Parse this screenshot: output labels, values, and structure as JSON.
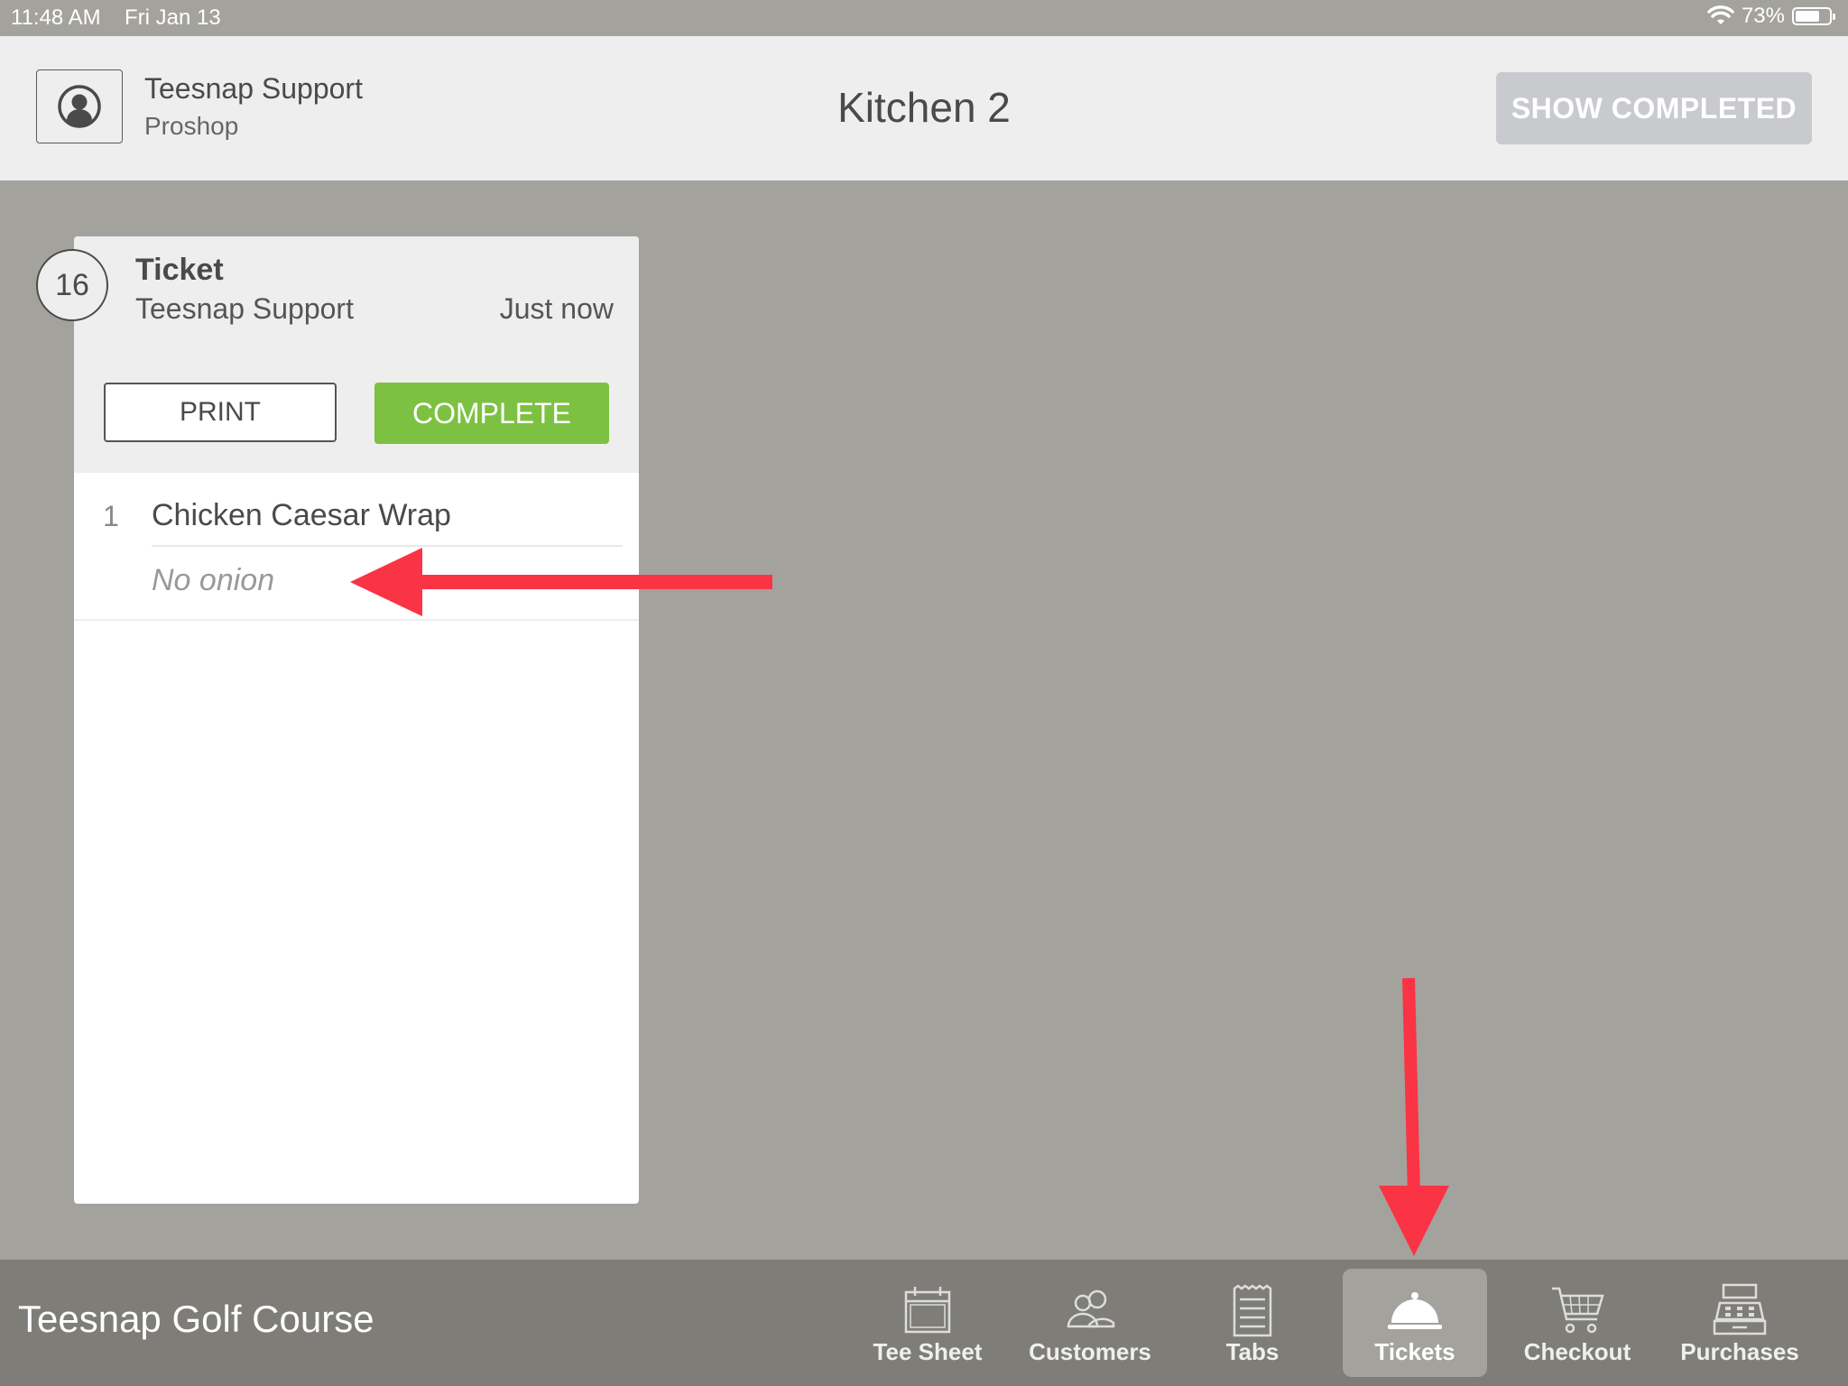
{
  "status_bar": {
    "time": "11:48 AM",
    "date": "Fri Jan 13",
    "battery": "73%",
    "battery_level": 0.73
  },
  "header": {
    "user_name": "Teesnap Support",
    "user_location": "Proshop",
    "title": "Kitchen 2",
    "show_completed_label": "SHOW COMPLETED"
  },
  "ticket": {
    "number": "16",
    "title": "Ticket",
    "customer": "Teesnap Support",
    "time": "Just now",
    "print_label": "PRINT",
    "complete_label": "COMPLETE",
    "items": [
      {
        "qty": "1",
        "name": "Chicken Caesar Wrap",
        "modifier": "No onion"
      }
    ]
  },
  "footer": {
    "course_name": "Teesnap Golf Course",
    "nav": [
      {
        "label": "Tee Sheet",
        "icon": "calendar-icon",
        "active": false
      },
      {
        "label": "Customers",
        "icon": "users-icon",
        "active": false
      },
      {
        "label": "Tabs",
        "icon": "tab-document-icon",
        "active": false
      },
      {
        "label": "Tickets",
        "icon": "cloche-icon",
        "active": true
      },
      {
        "label": "Checkout",
        "icon": "cart-icon",
        "active": false
      },
      {
        "label": "Purchases",
        "icon": "register-icon",
        "active": false
      }
    ]
  },
  "colors": {
    "accent_green": "#7dc142",
    "annotation_red": "#fa3345",
    "background": "#a3a29d"
  }
}
